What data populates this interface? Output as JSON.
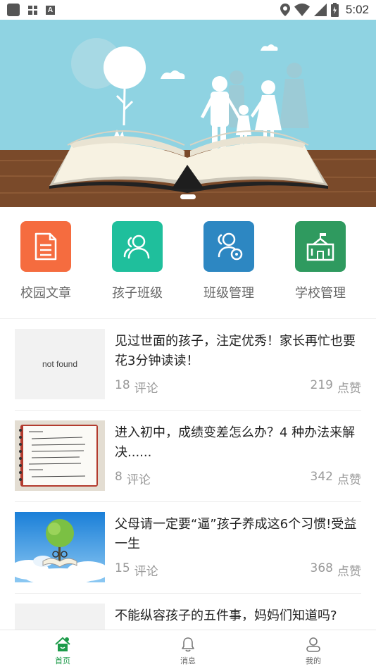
{
  "status_bar": {
    "time": "5:02"
  },
  "quick_menu": [
    {
      "label": "校园文章",
      "color": "#f56c3f",
      "icon": "document-icon"
    },
    {
      "label": "孩子班级",
      "color": "#1fbf9c",
      "icon": "people-icon"
    },
    {
      "label": "班级管理",
      "color": "#2d87c2",
      "icon": "people-gear-icon"
    },
    {
      "label": "学校管理",
      "color": "#2f9a5f",
      "icon": "school-icon"
    }
  ],
  "articles": [
    {
      "title": "见过世面的孩子，注定优秀！家长再忙也要花3分钟读读！",
      "thumb_text": "not found",
      "comments_count": "18",
      "comments_unit": "评论",
      "likes_count": "219",
      "likes_unit": "点赞"
    },
    {
      "title": "进入初中，成绩变差怎么办？4 种办法来解决......",
      "comments_count": "8",
      "comments_unit": "评论",
      "likes_count": "342",
      "likes_unit": "点赞"
    },
    {
      "title": "父母请一定要“逼”孩子养成这6个习惯!受益一生",
      "comments_count": "15",
      "comments_unit": "评论",
      "likes_count": "368",
      "likes_unit": "点赞"
    },
    {
      "title": "不能纵容孩子的五件事，妈妈们知道吗?"
    }
  ],
  "bottom_nav": [
    {
      "label": "首页",
      "icon": "home-icon",
      "active": true
    },
    {
      "label": "消息",
      "icon": "bell-icon",
      "active": false
    },
    {
      "label": "我的",
      "icon": "user-icon",
      "active": false
    }
  ],
  "colors": {
    "accent": "#1d9b4a",
    "sky": "#8fd3e2",
    "wood": "#7a4a2a"
  }
}
